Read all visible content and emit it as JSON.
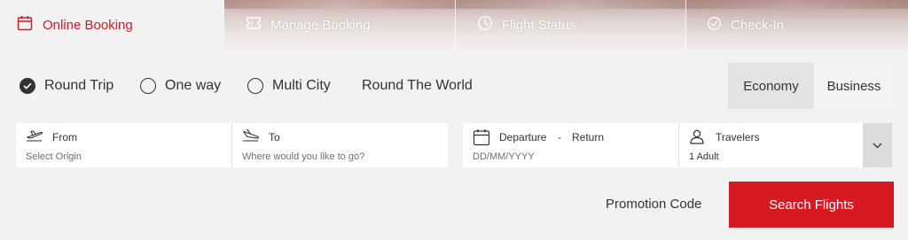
{
  "tabs": [
    {
      "label": "Online Booking",
      "icon": "calendar-icon",
      "active": true
    },
    {
      "label": "Manage Booking",
      "icon": "ticket-icon",
      "active": false
    },
    {
      "label": "Flight Status",
      "icon": "clock-icon",
      "active": false
    },
    {
      "label": "Check-In",
      "icon": "check-circle-icon",
      "active": false
    }
  ],
  "trip_types": [
    {
      "label": "Round Trip",
      "selected": true
    },
    {
      "label": "One way",
      "selected": false
    },
    {
      "label": "Multi City",
      "selected": false
    },
    {
      "label": "Round The World",
      "selected": false
    }
  ],
  "cabin": {
    "economy": "Economy",
    "business": "Business",
    "selected": "Economy"
  },
  "search": {
    "from": {
      "label": "From",
      "placeholder": "Select Origin"
    },
    "to": {
      "label": "To",
      "placeholder": "Where would you like to go?"
    },
    "dates": {
      "departure": "Departure",
      "dash": "-",
      "return": "Return",
      "placeholder": "DD/MM/YYYY"
    },
    "travelers": {
      "label": "Travelers",
      "value": "1 Adult"
    }
  },
  "actions": {
    "promo": "Promotion Code",
    "search": "Search Flights"
  },
  "colors": {
    "accent": "#d71921",
    "background": "#f3f2f2",
    "text": "#333333"
  }
}
